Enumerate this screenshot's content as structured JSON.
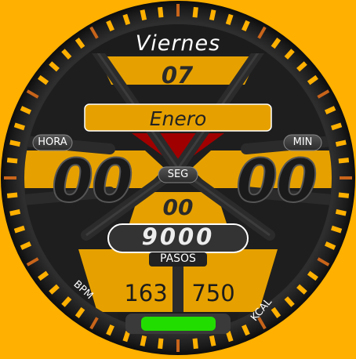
{
  "watchface": {
    "day_name": "Viernes",
    "day_number": "07",
    "month": "Enero",
    "hour_label": "HORA",
    "minute_label": "MIN",
    "seconds_label": "SEG",
    "hours": "00",
    "minutes": "00",
    "seconds": "00",
    "steps": "9000",
    "steps_label": "PASOS",
    "bpm_label": "BPM",
    "bpm_value": "163",
    "kcal_label": "KCAL",
    "kcal_value": "750",
    "battery_level": 0.95
  },
  "colors": {
    "background": "#ffb000",
    "accent": "#e6a100",
    "red_triangle": "#a00000",
    "battery": "#22dd00"
  }
}
